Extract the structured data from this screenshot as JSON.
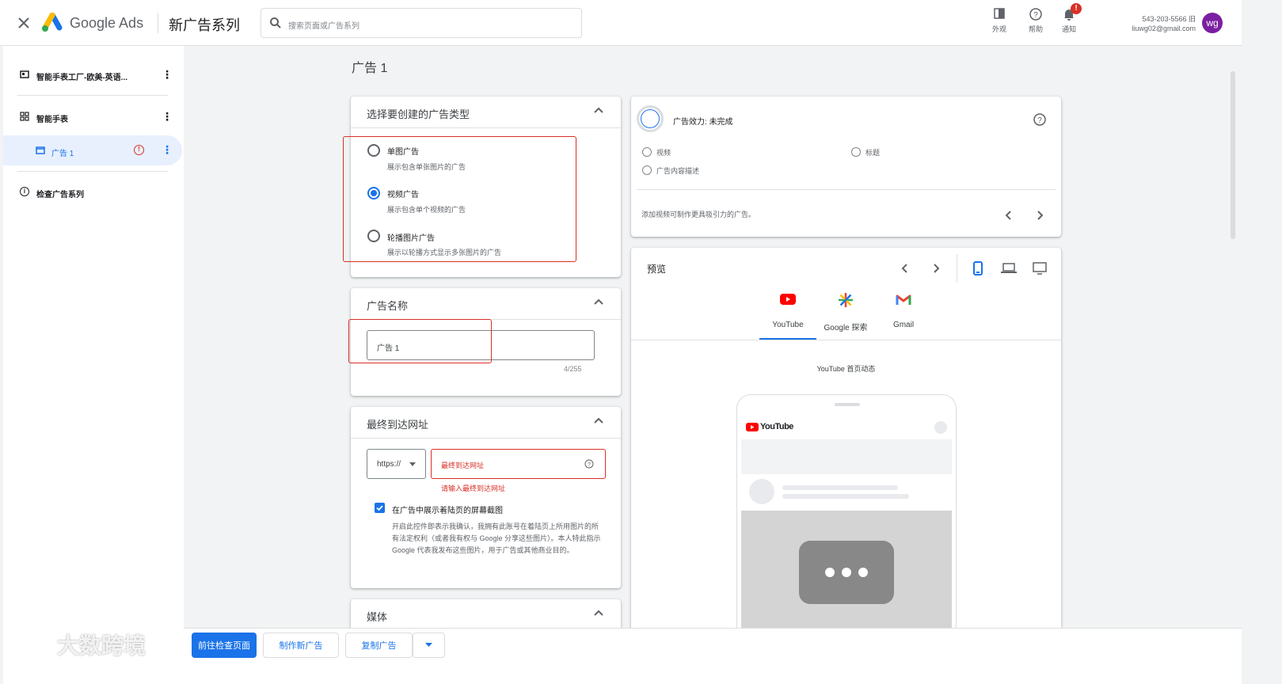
{
  "header": {
    "app_name": "Google Ads",
    "page_title": "新广告系列",
    "search_placeholder": "搜索页面或广告系列",
    "appearance": "外观",
    "help": "帮助",
    "notifications": "通知",
    "notif_badge": "!",
    "account_id": "543-203-5566 旧",
    "account_email": "liuwg02@gmail.com",
    "avatar": "wg"
  },
  "sidebar": {
    "campaign": "智能手表工厂-欧美-英语...",
    "adgroup": "智能手表",
    "ad": "广告 1",
    "review": "检查广告系列"
  },
  "main": {
    "title": "广告 1",
    "ad_type": {
      "title": "选择要创建的广告类型",
      "options": [
        {
          "label": "单图广告",
          "desc": "展示包含单张图片的广告",
          "selected": false
        },
        {
          "label": "视频广告",
          "desc": "展示包含单个视频的广告",
          "selected": true
        },
        {
          "label": "轮播图片广告",
          "desc": "展示以轮播方式显示多张图片的广告",
          "selected": false
        }
      ]
    },
    "ad_name": {
      "title": "广告名称",
      "value": "广告 1",
      "counter": "4/255"
    },
    "final_url": {
      "title": "最终到达网址",
      "protocol": "https://",
      "placeholder": "最终到达网址",
      "error": "请输入最终到达网址",
      "checkbox_label": "在广告中展示着陆页的屏幕截图",
      "checkbox_checked": true,
      "consent": "开启此控件即表示我确认，我拥有此账号在着陆页上所用图片的所有法定权利（或者我有权与 Google 分享这些图片）。本人特此指示 Google 代表我发布这些图片，用于广告或其他商业目的。"
    },
    "media": {
      "title": "媒体"
    }
  },
  "strength": {
    "title": "广告效力: 未完成",
    "items": [
      "视频",
      "标题",
      "广告内容描述"
    ],
    "tip": "添加视频可制作更具吸引力的广告。"
  },
  "preview": {
    "title": "预览",
    "tabs": [
      "YouTube",
      "Google 探索",
      "Gmail"
    ],
    "subtitle": "YouTube 首页动态",
    "yt_logo": "YouTube"
  },
  "footer": {
    "go_review": "前往检查页面",
    "new_ad": "制作新广告",
    "copy_ad": "复制广告"
  },
  "watermark": "大数跨境",
  "colors": {
    "primary": "#1a73e8",
    "error": "#d93025",
    "youtube_red": "#ff0000",
    "gmail_red": "#ea4335",
    "avatar": "#7b1fa2"
  }
}
